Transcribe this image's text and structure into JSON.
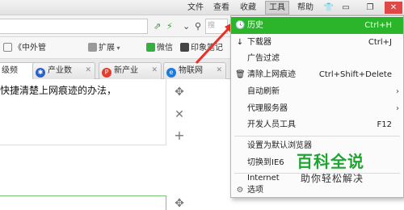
{
  "menubar": {
    "items": [
      "文件",
      "查看",
      "收藏",
      "工具",
      "帮助"
    ],
    "active": "工具",
    "window_controls": [
      "skin-icon",
      "minimize-icon",
      "restore-icon",
      "close-icon"
    ]
  },
  "address": {
    "search_placeholder": "搜"
  },
  "bookmarks": {
    "items": [
      "《中外管",
      "扩展",
      "微信",
      "印象笔记"
    ]
  },
  "tabs": [
    {
      "label": "级频",
      "icon_color": "#2a7bd6"
    },
    {
      "label": "产业数",
      "icon_color": "#2a62c9"
    },
    {
      "label": "新产业",
      "icon_color": "#e23d2d"
    },
    {
      "label": "物联网",
      "icon_color": "#1f7ad8"
    }
  ],
  "page": {
    "article_text": "快捷清楚上网痕迹的办法，"
  },
  "tools_menu": {
    "items": [
      {
        "label": "历史",
        "shortcut": "Ctrl+H",
        "icon": "clock-icon",
        "highlight": true
      },
      {
        "label": "下载器",
        "shortcut": "Ctrl+J",
        "icon": "download-icon"
      },
      {
        "label": "广告过滤",
        "shortcut": ""
      },
      {
        "label": "清除上网痕迹",
        "shortcut": "Ctrl+Shift+Delete",
        "icon": "trash-icon"
      },
      {
        "label": "自动刷新",
        "shortcut": "",
        "submenu": true
      },
      {
        "label": "代理服务器",
        "shortcut": "",
        "submenu": true
      },
      {
        "label": "开发人员工具",
        "shortcut": "F12"
      },
      {
        "label": "设置为默认浏览器",
        "shortcut": ""
      },
      {
        "label": "切换到IE6",
        "shortcut": ""
      },
      {
        "label": "Internet",
        "shortcut": ""
      },
      {
        "label": "选项",
        "shortcut": "",
        "icon": "gear-icon"
      }
    ]
  },
  "watermark": {
    "logo": "百科全说",
    "slogan": "助你轻松解决"
  },
  "colors": {
    "highlight": "#2ab52a",
    "arrow": "#e8302a",
    "watermark": "#1ea531"
  }
}
